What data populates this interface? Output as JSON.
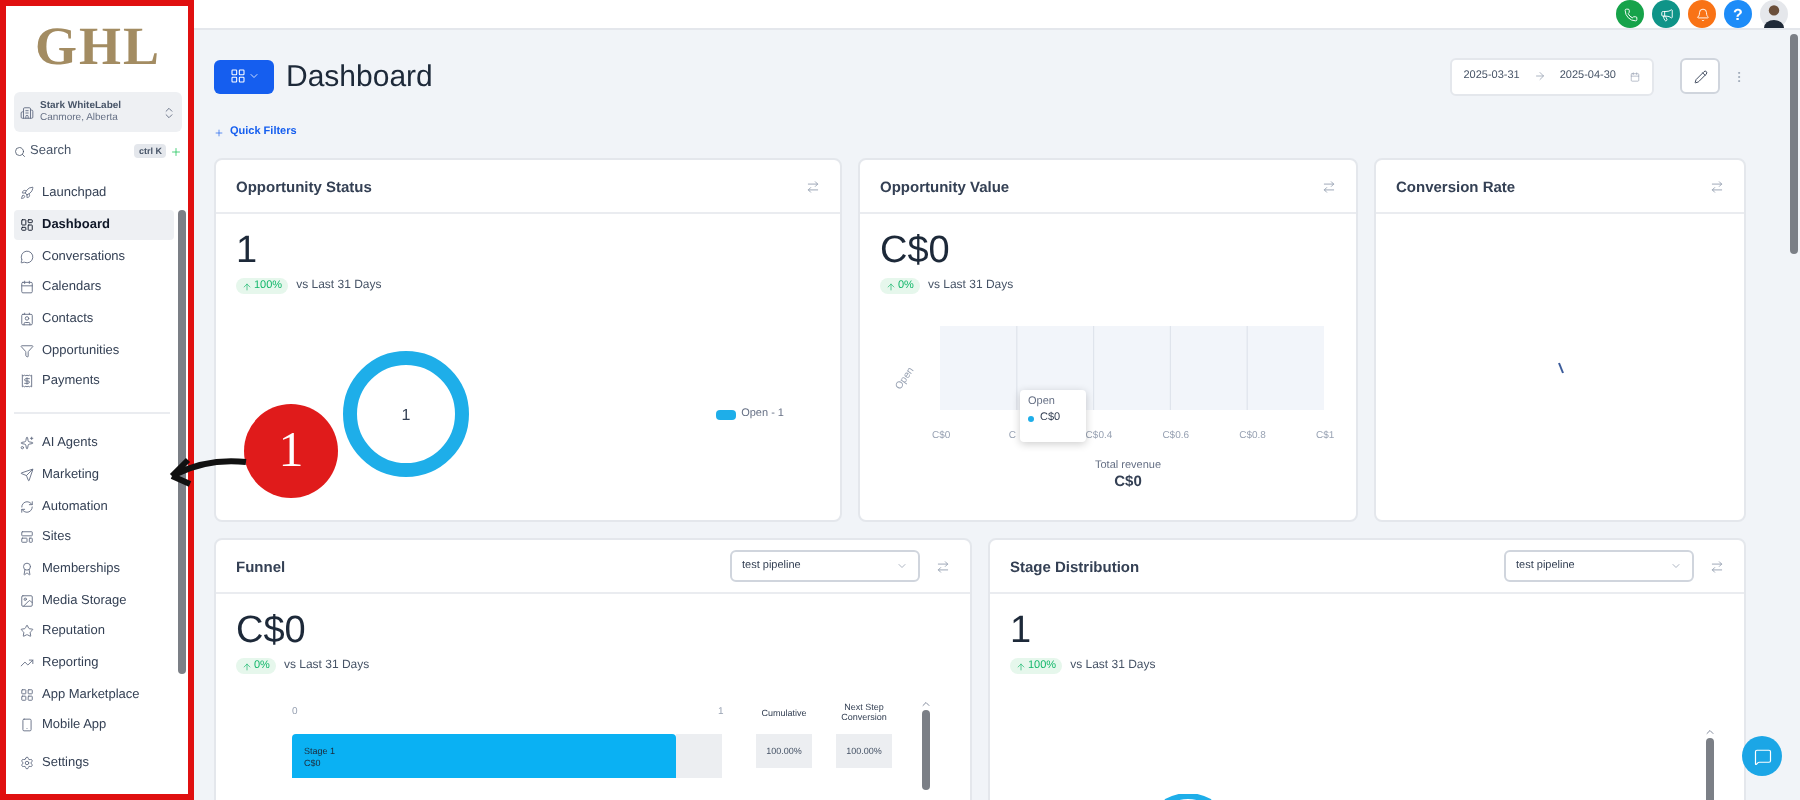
{
  "annotation": {
    "number": "1"
  },
  "sidebar": {
    "logo": "GHL",
    "account": {
      "name": "Stark WhiteLabel",
      "location": "Canmore, Alberta"
    },
    "search": {
      "placeholder": "Search",
      "shortcut": "ctrl K"
    },
    "groups": [
      [
        {
          "label": "Launchpad",
          "selected": false
        },
        {
          "label": "Dashboard",
          "selected": true
        },
        {
          "label": "Conversations",
          "selected": false
        },
        {
          "label": "Calendars",
          "selected": false
        },
        {
          "label": "Contacts",
          "selected": false
        },
        {
          "label": "Opportunities",
          "selected": false
        },
        {
          "label": "Payments",
          "selected": false
        }
      ],
      [
        {
          "label": "AI Agents",
          "selected": false
        },
        {
          "label": "Marketing",
          "selected": false
        },
        {
          "label": "Automation",
          "selected": false
        },
        {
          "label": "Sites",
          "selected": false
        },
        {
          "label": "Memberships",
          "selected": false
        },
        {
          "label": "Media Storage",
          "selected": false
        },
        {
          "label": "Reputation",
          "selected": false
        },
        {
          "label": "Reporting",
          "selected": false
        },
        {
          "label": "App Marketplace",
          "selected": false
        },
        {
          "label": "Mobile App",
          "selected": false
        }
      ]
    ],
    "footer": {
      "label": "Settings"
    }
  },
  "topbar": {
    "help": "?"
  },
  "header": {
    "title": "Dashboard",
    "quick_filters": "Quick Filters",
    "date_from": "2025-03-31",
    "date_to": "2025-04-30"
  },
  "cards": [
    {
      "kind": "donut",
      "title": "Opportunity Status",
      "value": "1",
      "change": "100%",
      "comparison": "vs Last 31 Days",
      "center_label": "1",
      "legend": "Open - 1"
    },
    {
      "kind": "bar",
      "title": "Opportunity Value",
      "value": "C$0",
      "change": "0%",
      "comparison": "vs Last 31 Days",
      "tooltip": {
        "title": "Open",
        "value": "C$0"
      },
      "total_label": "Total revenue",
      "total": "C$0",
      "category_label": "Open",
      "axis_labels": [
        "C$0",
        "C",
        "C$0.4",
        "C$0.6",
        "C$0.8",
        "C$1"
      ]
    },
    {
      "kind": "loading",
      "title": "Conversion Rate"
    },
    {
      "kind": "funnel",
      "title": "Funnel",
      "select": "test pipeline",
      "value": "C$0",
      "change": "0%",
      "comparison": "vs Last 31 Days",
      "bar_label": "Stage 1",
      "bar_value": "C$0",
      "axis_labels": [
        "0",
        "1"
      ],
      "table": {
        "columns": [
          "Cumulative",
          "Next Step Conversion"
        ],
        "rows": [
          [
            "100.00%",
            "100.00%"
          ]
        ]
      }
    },
    {
      "kind": "distribution",
      "title": "Stage Distribution",
      "select": "test pipeline",
      "value": "1",
      "change": "100%",
      "comparison": "vs Last 31 Days"
    }
  ]
}
